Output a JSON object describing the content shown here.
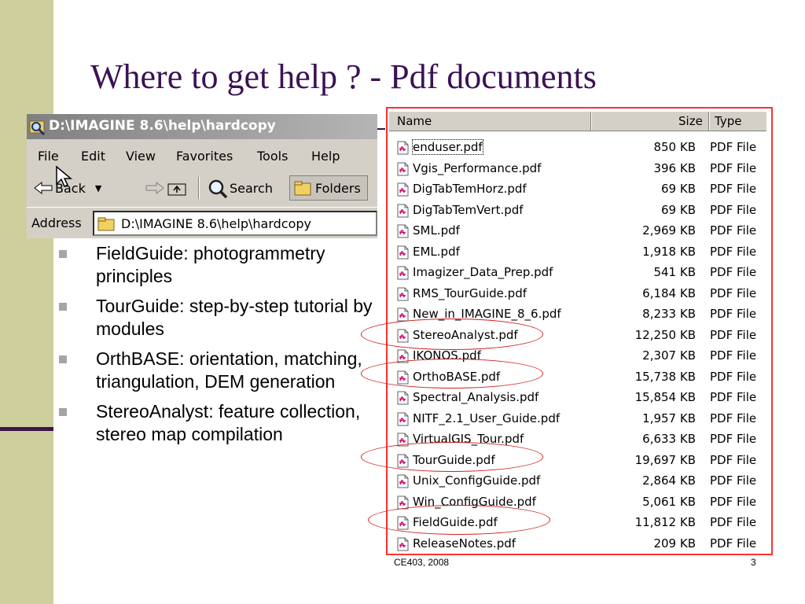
{
  "slide": {
    "title": "Where to get help ? - Pdf documents",
    "footer_course": "CE403, 2008",
    "page_number": "3"
  },
  "explorer": {
    "window_title": "D:\\IMAGINE 8.6\\help\\hardcopy",
    "menu": [
      "File",
      "Edit",
      "View",
      "Favorites",
      "Tools",
      "Help"
    ],
    "toolbar": {
      "back_label": "Back",
      "search_label": "Search",
      "folders_label": "Folders"
    },
    "address_label": "Address",
    "address_value": "D:\\IMAGINE 8.6\\help\\hardcopy"
  },
  "bullets": [
    "FieldGuide: photogrammetry principles",
    "TourGuide: step-by-step tutorial by modules",
    "OrthBASE: orientation, matching, triangulation, DEM generation",
    "StereoAnalyst: feature collection, stereo map compilation"
  ],
  "file_list": {
    "columns": [
      "Name",
      "Size",
      "Type"
    ],
    "rows": [
      {
        "name": "enduser.pdf",
        "size": "850 KB",
        "type": "PDF File"
      },
      {
        "name": "Vgis_Performance.pdf",
        "size": "396 KB",
        "type": "PDF File"
      },
      {
        "name": "DigTabTemHorz.pdf",
        "size": "69 KB",
        "type": "PDF File"
      },
      {
        "name": "DigTabTemVert.pdf",
        "size": "69 KB",
        "type": "PDF File"
      },
      {
        "name": "SML.pdf",
        "size": "2,969 KB",
        "type": "PDF File"
      },
      {
        "name": "EML.pdf",
        "size": "1,918 KB",
        "type": "PDF File"
      },
      {
        "name": "Imagizer_Data_Prep.pdf",
        "size": "541 KB",
        "type": "PDF File"
      },
      {
        "name": "RMS_TourGuide.pdf",
        "size": "6,184 KB",
        "type": "PDF File"
      },
      {
        "name": "New_in_IMAGINE_8_6.pdf",
        "size": "8,233 KB",
        "type": "PDF File"
      },
      {
        "name": "StereoAnalyst.pdf",
        "size": "12,250 KB",
        "type": "PDF File"
      },
      {
        "name": "IKONOS.pdf",
        "size": "2,307 KB",
        "type": "PDF File"
      },
      {
        "name": "OrthoBASE.pdf",
        "size": "15,738 KB",
        "type": "PDF File"
      },
      {
        "name": "Spectral_Analysis.pdf",
        "size": "15,854 KB",
        "type": "PDF File"
      },
      {
        "name": "NITF_2.1_User_Guide.pdf",
        "size": "1,957 KB",
        "type": "PDF File"
      },
      {
        "name": "VirtualGIS_Tour.pdf",
        "size": "6,633 KB",
        "type": "PDF File"
      },
      {
        "name": "TourGuide.pdf",
        "size": "19,697 KB",
        "type": "PDF File"
      },
      {
        "name": "Unix_ConfigGuide.pdf",
        "size": "2,864 KB",
        "type": "PDF File"
      },
      {
        "name": "Win_ConfigGuide.pdf",
        "size": "5,061 KB",
        "type": "PDF File"
      },
      {
        "name": "FieldGuide.pdf",
        "size": "11,812 KB",
        "type": "PDF File"
      },
      {
        "name": "ReleaseNotes.pdf",
        "size": "209 KB",
        "type": "PDF File"
      }
    ]
  },
  "colors": {
    "title": "#3b1254",
    "sidebar": "#cfcf9e",
    "highlight_ellipse": "#d02020",
    "list_border": "#ff3030"
  }
}
